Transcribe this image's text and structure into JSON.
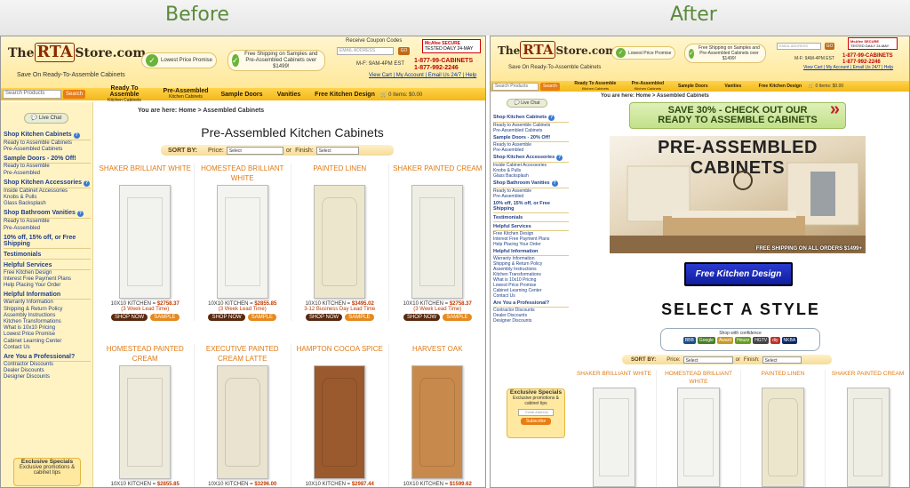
{
  "labels": {
    "before": "Before",
    "after": "After"
  },
  "header": {
    "logo_pre": "The",
    "logo_mid": "RTA",
    "logo_post": "Store.com",
    "tagline": "Save On Ready-To-Assemble Cabinets",
    "promise": "Lowest Price Promise",
    "shipping": "Free Shipping on Samples and Pre-Assembled Cabinets over $1499!",
    "coupon": "Receive Coupon Codes",
    "email_placeholder": "EMAIL ADDRESS",
    "go": "GO",
    "mcafee_top": "McAfee SECURE",
    "mcafee_bottom": "TESTED DAILY   24-MAY",
    "hours": "M-F: 9AM-4PM EST",
    "phone1": "1-877-99-CABINETS",
    "phone2": "1-877-992-2246",
    "links": "View Cart | My Account | Email Us 24/7 | Help"
  },
  "nav": {
    "search_placeholder": "Search Products",
    "search_button": "Search",
    "items": [
      {
        "label": "Ready To Assemble",
        "sub": "Kitchen Cabinets"
      },
      {
        "label": "Pre-Assembled",
        "sub": "Kitchen Cabinets"
      },
      {
        "label": "Sample Doors",
        "sub": ""
      },
      {
        "label": "Vanities",
        "sub": ""
      },
      {
        "label": "Free Kitchen Design",
        "sub": ""
      }
    ],
    "cart": "0 Items: $0.00"
  },
  "sidebar": {
    "live_chat": "Live Chat",
    "sections": [
      {
        "head": "Shop Kitchen Cabinets",
        "links": [
          "Ready to Assemble Cabinets",
          "Pre-Assembled Cabinets"
        ]
      },
      {
        "head": "Sample Doors - 20% Off!",
        "links": [
          "Ready to Assemble",
          "Pre-Assembled"
        ]
      },
      {
        "head": "Shop Kitchen Accessories",
        "links": [
          "Inside Cabinet Accessories",
          "Knobs & Pulls",
          "Glass Backsplash"
        ]
      },
      {
        "head": "Shop Bathroom Vanities",
        "links": [
          "Ready to Assemble",
          "Pre-Assembled"
        ]
      },
      {
        "head": "10% off, 15% off, or Free Shipping",
        "links": []
      },
      {
        "head": "Testimonials",
        "links": []
      },
      {
        "head": "Helpful Services",
        "links": [
          "Free Kitchen Design",
          "Interest Free Payment Plans",
          "Help Placing Your Order"
        ]
      },
      {
        "head": "Helpful Information",
        "links": [
          "Warranty Information",
          "Shipping & Return Policy",
          "Assembly Instructions",
          "Kitchen Transformations",
          "What is 10x10 Pricing",
          "Lowest Price Promise",
          "Cabinet Learning Center",
          "Contact Us"
        ]
      },
      {
        "head": "Are You a Professional?",
        "links": [
          "Contractor Discounts",
          "Dealer Discounts",
          "Designer Discounts"
        ]
      }
    ],
    "exclusive_title": "Exclusive Specials",
    "exclusive_sub": "Exclusive promotions & cabinet tips",
    "email_placeholder": "Email Address",
    "subscribe": "Subscribe"
  },
  "main": {
    "breadcrumb_before": "You are here: Home > Assembled Cabinets",
    "breadcrumb_after": "You are here: Home > Assembled Cabinets",
    "title": "Pre-Assembled Kitchen Cabinets",
    "sort_by": "SORT BY:",
    "price_label": "Price:",
    "or_label": "or",
    "finish_label": "Finish:",
    "select": "Select",
    "products_row1": [
      {
        "name": "SHAKER BRILLIANT WHITE",
        "price_label": "10X10 KITCHEN = ",
        "price": "$2758.37",
        "lead": "(3 Week Lead Time)",
        "color": "#f2f2ee",
        "style": "shaker"
      },
      {
        "name": "HOMESTEAD BRILLIANT WHITE",
        "price_label": "10X10 KITCHEN = ",
        "price": "$2855.85",
        "lead": "(3 Week Lead Time)",
        "color": "#f3f3ef",
        "style": "shaker"
      },
      {
        "name": "PAINTED LINEN",
        "price_label": "10X10 KITCHEN = ",
        "price": "$3495.02",
        "lead": "3-12 Business Day Lead Time",
        "color": "#ece7cc",
        "style": "raised"
      },
      {
        "name": "SHAKER PAINTED CREAM",
        "price_label": "10X10 KITCHEN = ",
        "price": "$2758.37",
        "lead": "(3 Week Lead Time)",
        "color": "#efeee4",
        "style": "shaker"
      }
    ],
    "products_row2": [
      {
        "name": "HOMESTEAD PAINTED CREAM",
        "price_label": "10X10 KITCHEN = ",
        "price": "$2855.85",
        "color": "#eeeadb",
        "style": "shaker"
      },
      {
        "name": "EXECUTIVE PAINTED CREAM LATTE",
        "price_label": "10X10 KITCHEN = ",
        "price": "$3296.00",
        "color": "#e9e3cf",
        "style": "raised"
      },
      {
        "name": "HAMPTON COCOA SPICE",
        "price_label": "10X10 KITCHEN = ",
        "price": "$2987.44",
        "color": "#9a5a2e",
        "style": "raised"
      },
      {
        "name": "HARVEST OAK",
        "price_label": "10X10 KITCHEN = ",
        "price": "$1599.62",
        "color": "#c88a4c",
        "style": "raised"
      }
    ],
    "shop_now": "SHOP NOW",
    "sample": "SAMPLE"
  },
  "after": {
    "save_line1": "SAVE 30% - CHECK OUT OUR",
    "save_line2": "READY TO ASSEMBLE CABINETS",
    "hero_title": "PRE-ASSEMBLED CABINETS",
    "hero_note": "FREE SHIPPING ON ALL ORDERS $1499+",
    "free_design": "Free Kitchen Design",
    "select_style": "SELECT A STYLE",
    "confidence": "Shop with confidence",
    "badges": [
      "BBB",
      "Google",
      "Award",
      "Houzz",
      "HGTV",
      "diy",
      "NKBA"
    ]
  }
}
